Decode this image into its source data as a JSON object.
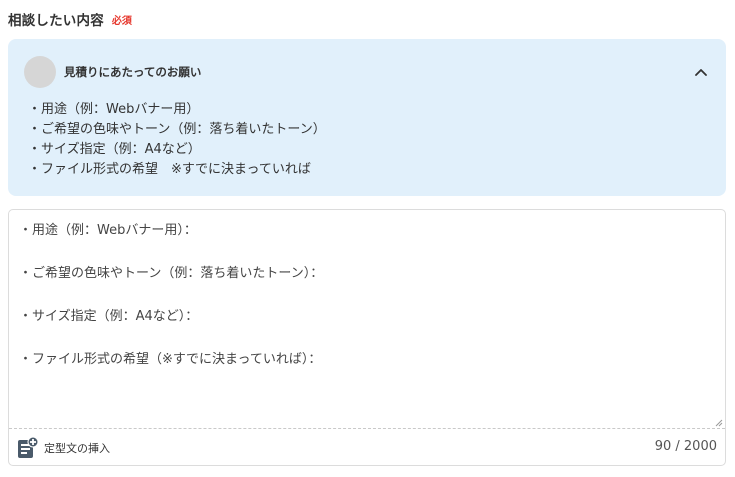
{
  "field": {
    "label": "相談したい内容",
    "required": "必須"
  },
  "guide": {
    "title": "見積りにあたってのお願い",
    "toggle_icon": "chevron-up-icon",
    "items": [
      "・用途（例：Webバナー用）",
      "・ご希望の色味やトーン（例：落ち着いたトーン）",
      "・サイズ指定（例：A4など）",
      "・ファイル形式の希望　※すでに決まっていれば"
    ]
  },
  "editor": {
    "lines": [
      "・用途（例：Webバナー用）：",
      "",
      "・ご希望の色味やトーン（例：落ち着いたトーン）：",
      "",
      "・サイズ指定（例：A4など）：",
      "",
      "・ファイル形式の希望（※すでに決まっていれば）：",
      "",
      ""
    ],
    "char_count": "90 / 2000"
  },
  "footer": {
    "insert_template_label": "定型文の挿入",
    "insert_template_icon": "document-add-icon"
  },
  "colors": {
    "guide_background": "#e1f0fb",
    "required": "#e6392f",
    "text": "#333333"
  }
}
